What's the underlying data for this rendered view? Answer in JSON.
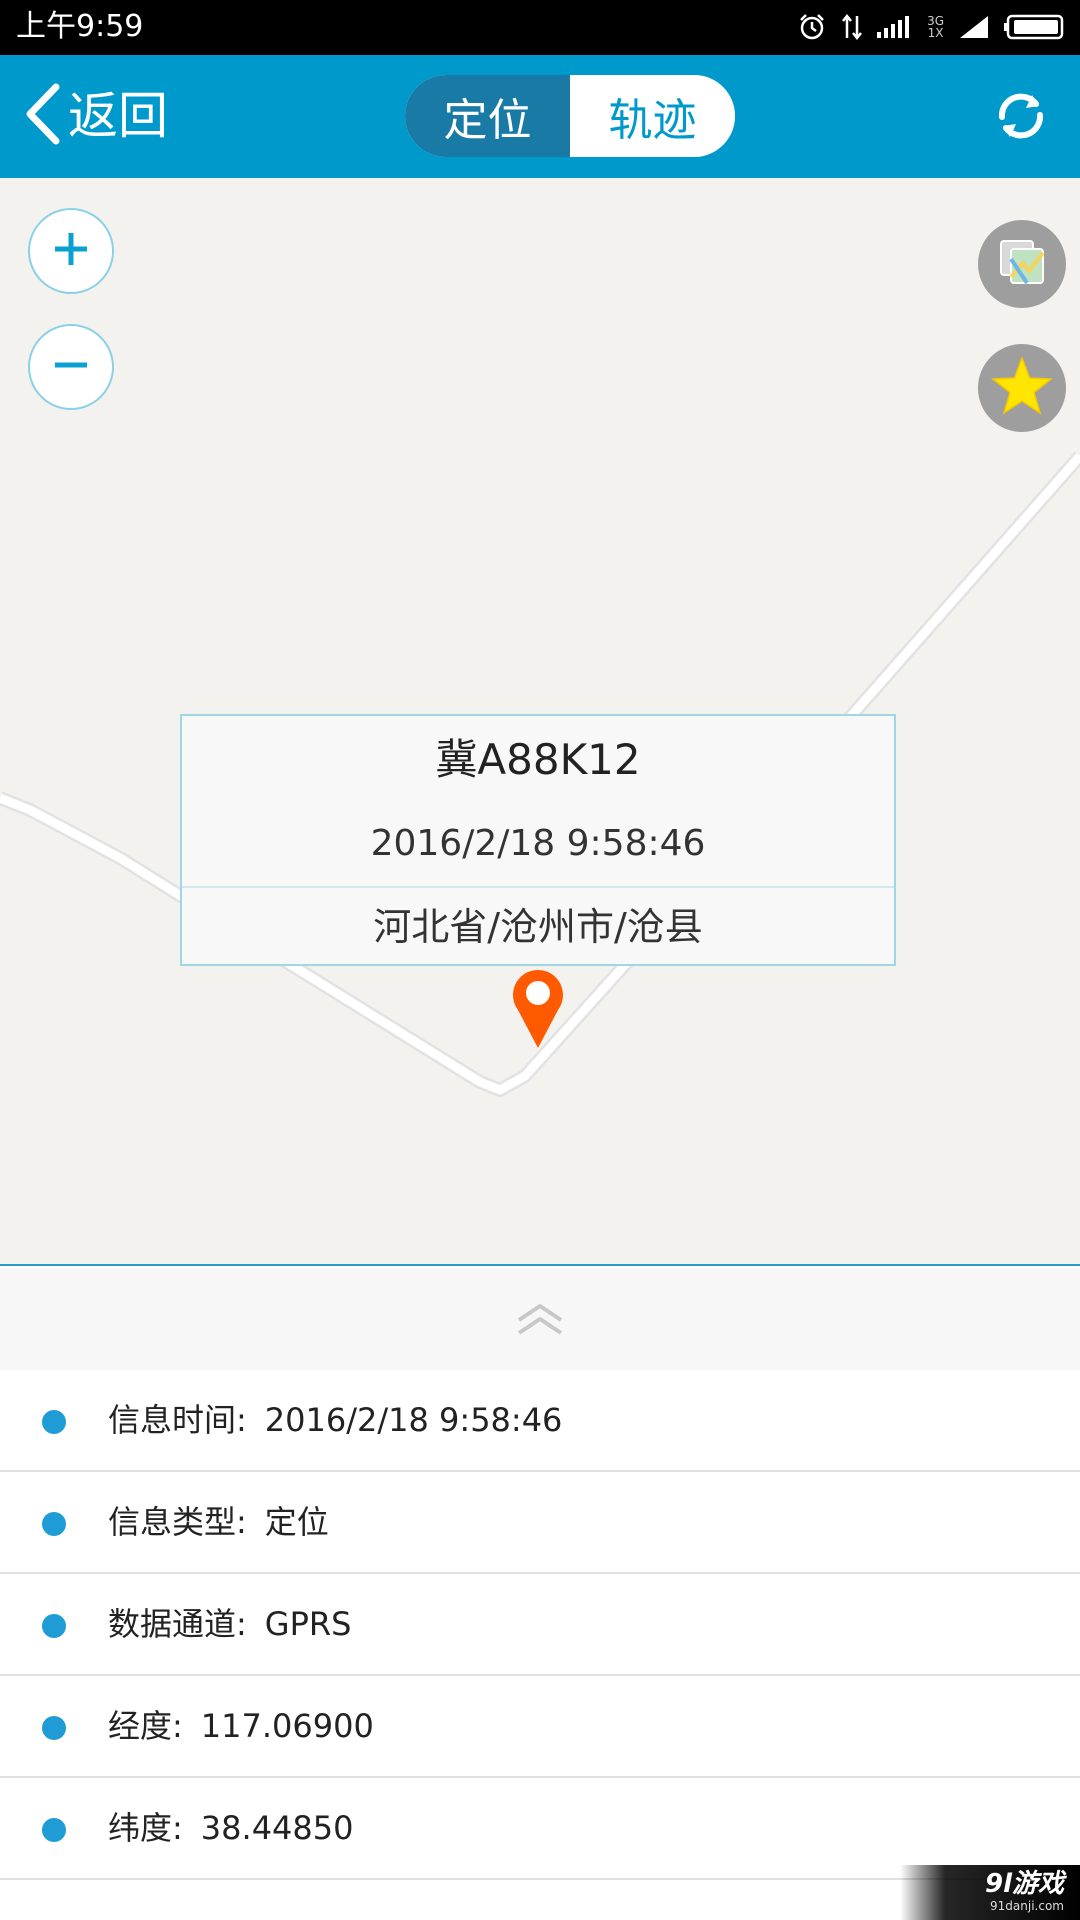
{
  "status_bar": {
    "time": "上午9:59",
    "network_label_top": "3G",
    "network_label_bottom": "1X",
    "icons": [
      "alarm-icon",
      "data-transfer-icon",
      "signal-icon",
      "signal-icon",
      "battery-icon"
    ]
  },
  "header": {
    "back_label": "返回",
    "tabs": [
      {
        "label": "定位",
        "active": true
      },
      {
        "label": "轨迹",
        "active": false
      }
    ],
    "refresh_icon": "refresh-icon",
    "colors": {
      "bar": "#0099cc",
      "active_tab": "#1a7aa6"
    }
  },
  "map": {
    "controls": [
      "zoom-in-icon",
      "zoom-out-icon",
      "map-layer-icon",
      "star-icon"
    ],
    "popup": {
      "plate": "冀A88K12",
      "time": "2016/2/18 9:58:46",
      "address": "河北省/沧州市/沧县"
    },
    "marker": {
      "icon": "location-pin-icon",
      "color": "#ff5a00"
    }
  },
  "details": {
    "rows": [
      {
        "label": "信息时间:",
        "value": "2016/2/18 9:58:46"
      },
      {
        "label": "信息类型:",
        "value": "定位"
      },
      {
        "label": "数据通道:",
        "value": "GPRS"
      },
      {
        "label": "经度:",
        "value": "117.06900"
      },
      {
        "label": "纬度:",
        "value": "38.44850"
      }
    ]
  },
  "watermark": {
    "main": "9l游戏",
    "sub": "91danji.com"
  }
}
